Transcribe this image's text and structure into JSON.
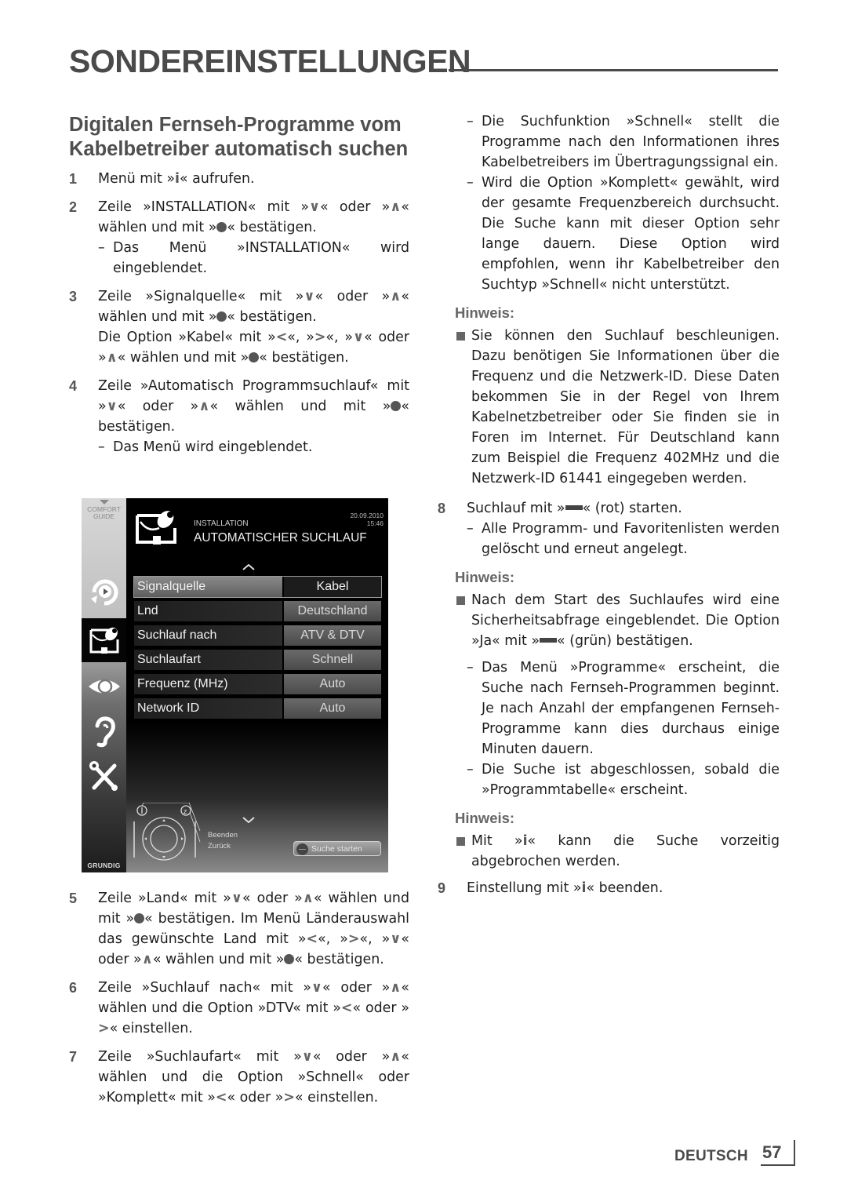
{
  "header": {
    "title": "SONDEREINSTELLUNGEN"
  },
  "left": {
    "heading": "Digitalen Fernseh-Programme vom Kabelbetreiber automatisch suchen",
    "steps": [
      {
        "num": "1",
        "a": "Menü mit »",
        "icon": "i",
        "b": "« aufrufen."
      },
      {
        "num": "2",
        "a": "Zeile »INSTALLATION« mit »",
        "b": "« oder »",
        "c": "« wählen und mit »",
        "d": "« bestätigen.",
        "sub": "Das Menü »INSTALLATION« wird eingeblendet."
      },
      {
        "num": "3",
        "a": "Zeile »Signalquelle« mit »",
        "b": "« oder »",
        "c": "« wählen und mit »",
        "d": "« bestätigen.",
        "e": "Die Option »Kabel« mit »",
        "f": "«, »",
        "g": "«, »",
        "h": "« oder »",
        "i": "« wählen und mit »",
        "j": "« bestätigen."
      },
      {
        "num": "4",
        "a": "Zeile »Automatisch Programmsuchlauf« mit »",
        "b": "« oder »",
        "c": "« wählen und mit »",
        "d": "« bestätigen.",
        "sub": "Das Menü wird eingeblendet."
      },
      {
        "num": "5",
        "a": "Zeile »Land« mit »",
        "b": "« oder »",
        "c": "« wählen und mit »",
        "d": "« bestätigen. Im Menü Länderauswahl das gewünschte Land mit »",
        "e": "«, »",
        "f": "«, »",
        "g": "« oder »",
        "h": "« wählen und mit »",
        "i": "« bestätigen."
      },
      {
        "num": "6",
        "a": "Zeile »Suchlauf nach« mit »",
        "b": "« oder »",
        "c": "« wählen und die Option »DTV« mit »",
        "d": "« oder »",
        "e": "« einstellen."
      },
      {
        "num": "7",
        "a": "Zeile »Suchlaufart« mit »",
        "b": "« oder »",
        "c": "« wählen und die Option »Schnell« oder »Komplett« mit »",
        "d": "« oder »",
        "e": "« einstellen."
      }
    ]
  },
  "tv": {
    "comfort_guide": [
      "COMFORT",
      "GUIDE"
    ],
    "subtitle": "INSTALLATION",
    "title": "AUTOMATISCHER SUCHLAUF",
    "date": "20.09.2010",
    "time": "15:46",
    "rows": [
      {
        "label": "Signalquelle",
        "value": "Kabel",
        "selected": true
      },
      {
        "label": "Lnd",
        "value": "Deutschland"
      },
      {
        "label": "Suchlauf nach",
        "value": "ATV & DTV"
      },
      {
        "label": "Suchlaufart",
        "value": "Schnell"
      },
      {
        "label": "Frequenz (MHz)",
        "value": "Auto"
      },
      {
        "label": "Network ID",
        "value": "Auto"
      }
    ],
    "hint_exit": "Beenden",
    "hint_back": "Zurück",
    "start_button": "Suche starten",
    "brand": "GRUNDIG",
    "sidebar_icons": [
      "source-icon",
      "installation-icon",
      "picture-icon",
      "sound-icon",
      "settings-icon"
    ],
    "active_sidebar_item": "installation-icon"
  },
  "right": {
    "dash1": "Die Suchfunktion »Schnell« stellt die Programme nach den Informationen ihres Kabelbetreibers im Übertragungssignal ein.",
    "dash2": "Wird die Option »Komplett« gewählt, wird der gesamte Frequenzbereich durchsucht. Die Suche kann mit dieser Option sehr lange dauern. Diese Option wird empfohlen, wenn ihr Kabelbetreiber den Suchtyp »Schnell« nicht unterstützt.",
    "note1_title": "Hinweis:",
    "note1": "Sie können den Suchlauf beschleunigen. Dazu benötigen Sie Informationen über die Frequenz und die Netzwerk-ID. Diese Daten bekommen Sie in der Regel von Ihrem Kabelnetzbetreiber oder Sie finden sie in Foren im Internet. Für Deutschland kann zum Beispiel die Frequenz 402MHz und die Netzwerk-ID 61441 eingegeben werden.",
    "step8": {
      "num": "8",
      "a": "Suchlauf mit »",
      "b": "« (rot) starten.",
      "sub": "Alle Programm- und Favoritenlisten werden gelöscht und erneut angelegt."
    },
    "note2_title": "Hinweis:",
    "note2_a": "Nach dem Start des Suchlaufes wird eine Sicherheitsabfrage eingeblendet. Die Option »Ja« mit »",
    "note2_b": "« (grün) bestätigen.",
    "dash3": "Das Menü »Programme« erscheint, die Suche nach Fernseh-Programmen beginnt. Je nach Anzahl der empfangenen Fernseh-Programme kann dies durchaus einige Minuten dauern.",
    "dash4": "Die Suche ist abgeschlossen, sobald die »Programmtabelle« erscheint.",
    "note3_title": "Hinweis:",
    "note3_a": "Mit »",
    "note3_b": "« kann die Suche vorzeitig abgebrochen werden.",
    "step9": {
      "num": "9",
      "a": "Einstellung mit »",
      "b": "« beenden."
    }
  },
  "symbols": {
    "i": "i",
    "down": "∨",
    "up": "∧",
    "left": "<",
    "right": ">"
  },
  "footer": {
    "language": "DEUTSCH",
    "page": "57"
  }
}
